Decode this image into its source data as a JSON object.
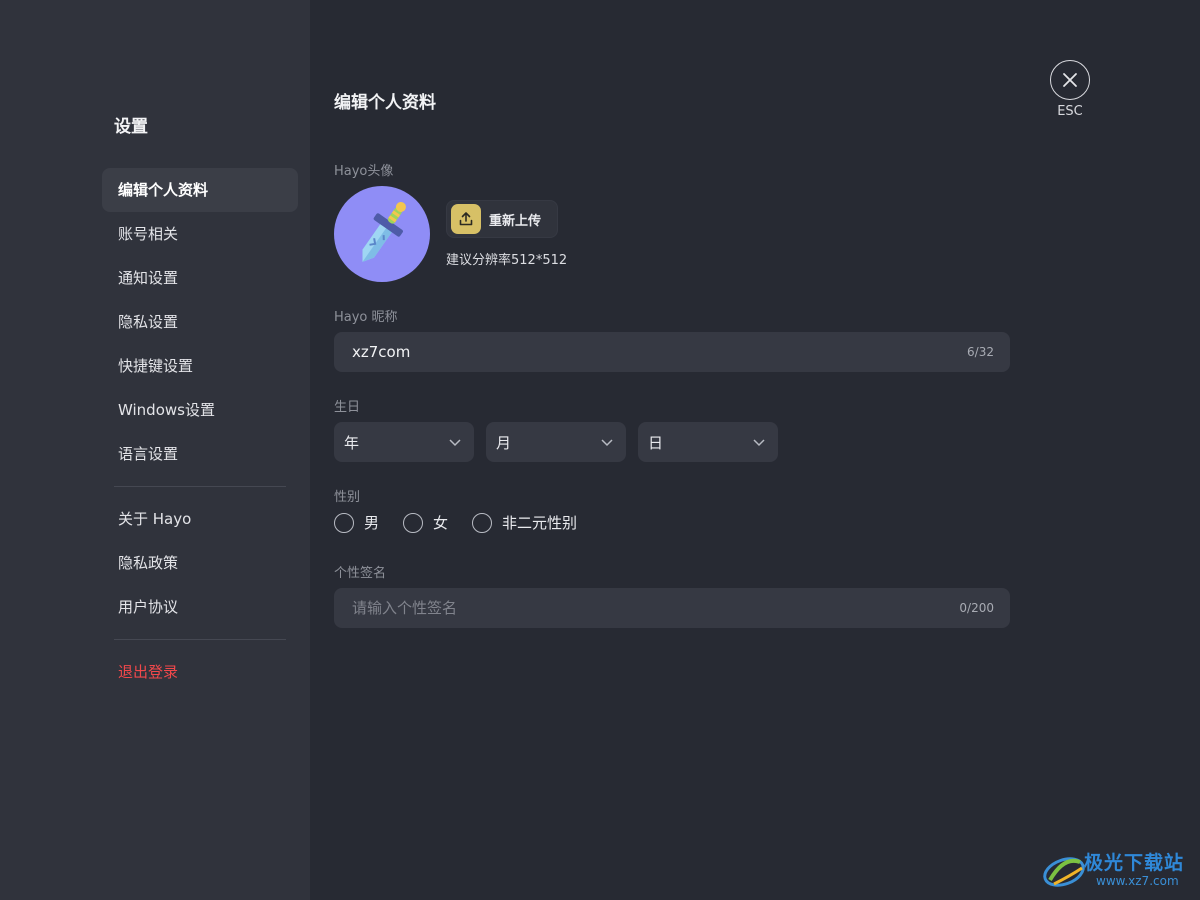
{
  "sidebar": {
    "title": "设置",
    "primary_items": [
      {
        "label": "编辑个人资料",
        "active": true
      },
      {
        "label": "账号相关"
      },
      {
        "label": "通知设置"
      },
      {
        "label": "隐私设置"
      },
      {
        "label": "快捷键设置"
      },
      {
        "label": "Windows设置"
      },
      {
        "label": "语言设置"
      }
    ],
    "secondary_items": [
      {
        "label": "关于 Hayo"
      },
      {
        "label": "隐私政策"
      },
      {
        "label": "用户协议"
      }
    ],
    "logout_label": "退出登录"
  },
  "main": {
    "title": "编辑个人资料",
    "avatar": {
      "label": "Hayo头像",
      "upload_label": "重新上传",
      "resolution_hint": "建议分辨率512*512"
    },
    "nickname": {
      "label": "Hayo 昵称",
      "value": "xz7com",
      "counter": "6/32"
    },
    "birthday": {
      "label": "生日",
      "year": "年",
      "month": "月",
      "day": "日"
    },
    "gender": {
      "label": "性别",
      "options": [
        "男",
        "女",
        "非二元性别"
      ]
    },
    "signature": {
      "label": "个性签名",
      "placeholder": "请输入个性签名",
      "counter": "0/200"
    }
  },
  "close": {
    "esc_label": "ESC"
  },
  "watermark": {
    "text": "极光下载站",
    "url": "www.xz7.com"
  },
  "colors": {
    "background": "#272a33",
    "sidebar": "#30333c",
    "input": "#363943",
    "accent_upload": "#d7c066",
    "avatar_bg": "#8f8df6",
    "danger": "#f2484b"
  }
}
